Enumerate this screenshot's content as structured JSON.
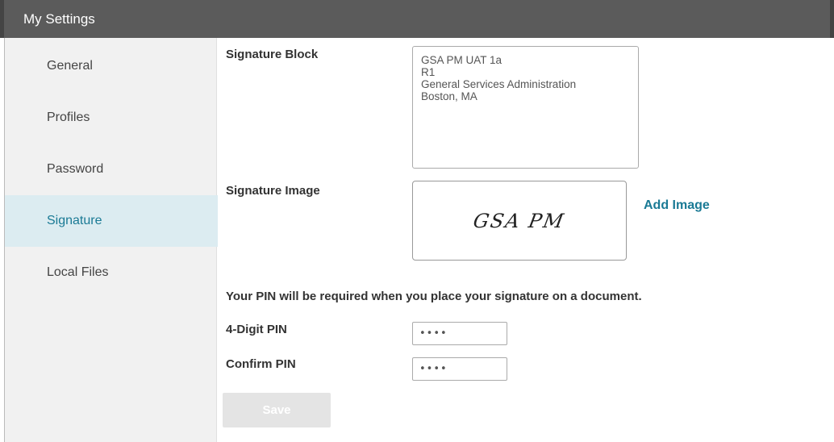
{
  "app": {
    "title": "My Settings"
  },
  "sidebar": {
    "items": [
      {
        "label": "General"
      },
      {
        "label": "Profiles"
      },
      {
        "label": "Password"
      },
      {
        "label": "Signature"
      },
      {
        "label": "Local Files"
      }
    ],
    "active": "Signature"
  },
  "signature_block": {
    "label": "Signature Block",
    "lines": [
      "GSA PM UAT 1a",
      "R1",
      "General Services Administration",
      "Boston, MA"
    ]
  },
  "signature_image": {
    "label": "Signature Image",
    "signature_text": "GSA PM",
    "add_image_label": "Add Image"
  },
  "pin": {
    "note": "Your PIN will be required when you place your signature on a document.",
    "pin_label": "4-Digit PIN",
    "pin_value": "••••",
    "confirm_label": "Confirm PIN",
    "confirm_value": "••••"
  },
  "actions": {
    "save_label": "Save"
  },
  "colors": {
    "header_bg": "#5b5b5b",
    "accent": "#1a7a95",
    "active_bg": "#dcecf1"
  }
}
